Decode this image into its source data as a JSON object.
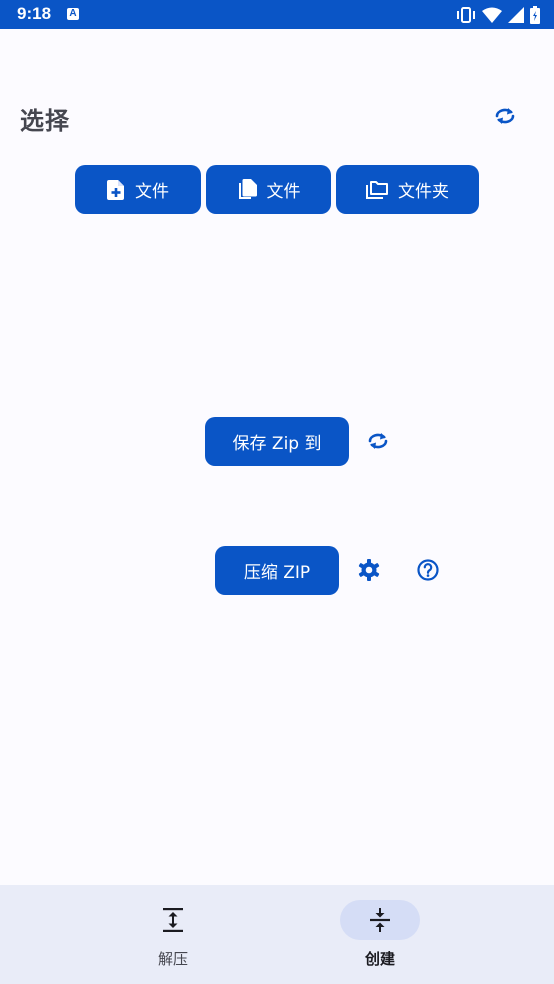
{
  "status_bar": {
    "time": "9:18",
    "notification_icon_letter": "A",
    "icons": [
      "vibrate-icon",
      "wifi-icon",
      "signal-icon",
      "battery-icon"
    ]
  },
  "header": {
    "title": "选择",
    "refresh_icon": "refresh-icon"
  },
  "select_buttons": [
    {
      "label": "文件",
      "icon": "file-add-icon"
    },
    {
      "label": "文件",
      "icon": "files-copy-icon"
    },
    {
      "label": "文件夹",
      "icon": "folder-copy-icon"
    }
  ],
  "save_section": {
    "save_label": "保存 Zip 到",
    "refresh_icon": "refresh-icon"
  },
  "compress_section": {
    "compress_label": "压缩 ZIP",
    "settings_icon": "gear-icon",
    "help_icon": "help-icon"
  },
  "bottom_nav": {
    "items": [
      {
        "label": "解压",
        "icon": "extract-icon",
        "active": false
      },
      {
        "label": "创建",
        "icon": "compress-icon",
        "active": true
      }
    ]
  },
  "colors": {
    "accent": "#0a55c6",
    "background": "#fcfbff",
    "nav_background": "#e9ecf8",
    "nav_active_pill": "#d5ddf6"
  }
}
